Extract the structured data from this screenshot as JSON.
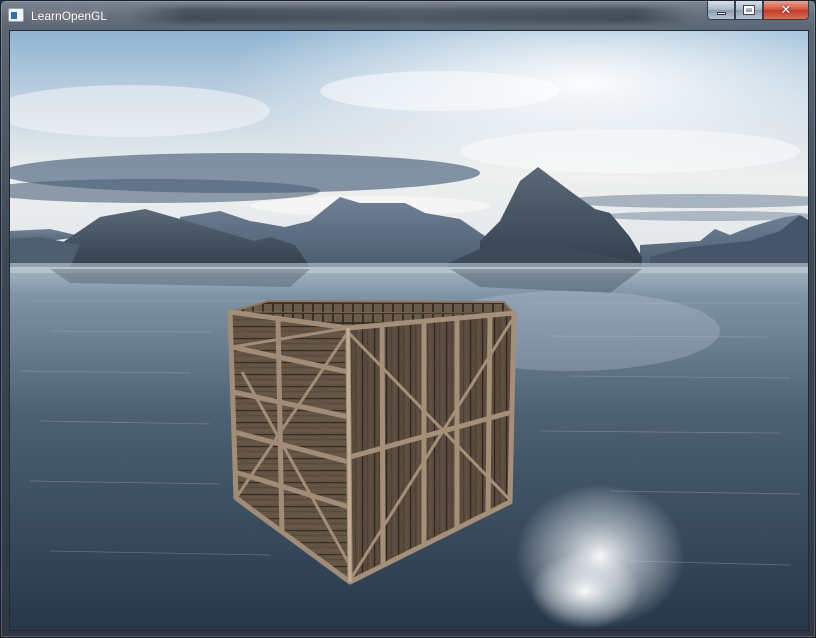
{
  "window": {
    "title": "LearnOpenGL",
    "controls": {
      "minimize": "minimize",
      "maximize": "maximize",
      "close": "close"
    }
  },
  "scene": {
    "description_items": [
      "skybox",
      "water",
      "mountains",
      "crate"
    ],
    "colors": {
      "sky_top": "#9fc0d9",
      "sky_haze": "#e9edf0",
      "cloud_band": "#5e7289",
      "mountain_dark": "#3d4a58",
      "mountain_mid": "#5f6e7f",
      "water_far": "#8ea3b6",
      "water_near": "#2c3c4d",
      "crate_wood": "#6b5a4a",
      "crate_frame": "#9a8670"
    }
  }
}
